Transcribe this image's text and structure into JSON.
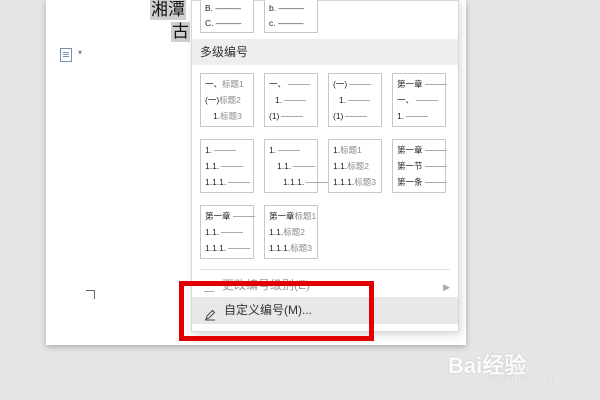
{
  "document": {
    "line1": "湘潭",
    "line2": "古"
  },
  "menu": {
    "top_cards": [
      {
        "lines": [
          "B. ———",
          "C. ———"
        ]
      },
      {
        "lines": [
          "b. ———",
          "c. ———"
        ]
      }
    ],
    "heading": "多级编号",
    "cards": [
      {
        "lines": [
          [
            "一、",
            "标题1"
          ],
          [
            "(一)",
            "标题2"
          ],
          [
            "1.",
            "标题3"
          ]
        ]
      },
      {
        "lines": [
          [
            "一、",
            ""
          ],
          [
            "1.",
            ""
          ],
          [
            "(1)",
            ""
          ]
        ]
      },
      {
        "lines": [
          [
            "(一)",
            ""
          ],
          [
            "1.",
            ""
          ],
          [
            "(1)",
            ""
          ]
        ]
      },
      {
        "lines": [
          [
            "第一章",
            ""
          ],
          [
            "一、",
            ""
          ],
          [
            "1.",
            ""
          ]
        ]
      },
      {
        "lines": [
          [
            "1.",
            ""
          ],
          [
            "1.1.",
            ""
          ],
          [
            "1.1.1.",
            ""
          ]
        ]
      },
      {
        "lines": [
          [
            "1.",
            ""
          ],
          [
            "1.1.",
            ""
          ],
          [
            "1.1.1.",
            ""
          ]
        ]
      },
      {
        "lines": [
          [
            "1.",
            "标题1"
          ],
          [
            "1.1.",
            "标题2"
          ],
          [
            "1.1.1.",
            "标题3"
          ]
        ]
      },
      {
        "lines": [
          [
            "第一章",
            ""
          ],
          [
            "第一节",
            ""
          ],
          [
            "第一条",
            ""
          ]
        ]
      },
      {
        "lines": [
          [
            "第一章",
            ""
          ],
          [
            "1.1.",
            ""
          ],
          [
            "1.1.1.",
            ""
          ]
        ]
      },
      {
        "lines": [
          [
            "第一章",
            "标题1"
          ],
          [
            "1.1.",
            "标题2"
          ],
          [
            "1.1.1.",
            "标题3"
          ]
        ]
      }
    ],
    "faded_item": "更改编号级别(E)",
    "custom_item": "自定义编号(M)..."
  },
  "watermark": {
    "brand": "Bai经验",
    "url": "jingyan.baidu.com"
  },
  "colors": {
    "highlight_box": "#e00000",
    "selection": "#cfcfcf"
  }
}
